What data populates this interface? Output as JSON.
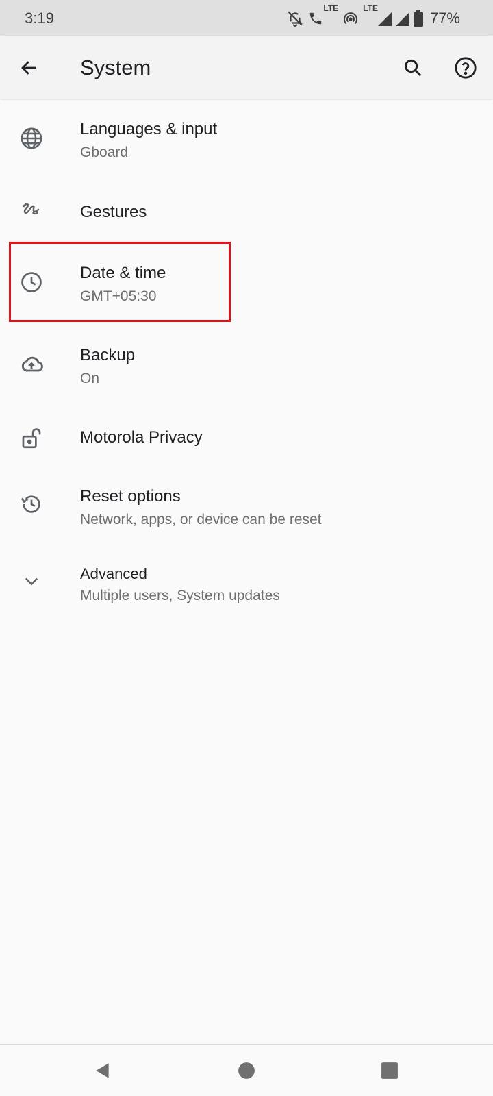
{
  "status_bar": {
    "time": "3:19",
    "lte_label": "LTE",
    "network_label": "LTE",
    "battery": "77%"
  },
  "app_bar": {
    "title": "System"
  },
  "items": [
    {
      "title": "Languages & input",
      "subtitle": "Gboard",
      "icon": "globe-icon"
    },
    {
      "title": "Gestures",
      "icon": "gestures-icon"
    },
    {
      "title": "Date & time",
      "subtitle": "GMT+05:30",
      "icon": "clock-icon"
    },
    {
      "title": "Backup",
      "subtitle": "On",
      "icon": "cloud-upload-icon"
    },
    {
      "title": "Motorola Privacy",
      "icon": "unlocked-padlock-icon"
    },
    {
      "title": "Reset options",
      "subtitle": "Network, apps, or device can be reset",
      "icon": "history-icon"
    },
    {
      "title": "Advanced",
      "subtitle": "Multiple users, System updates",
      "icon": "chevron-down-icon"
    }
  ],
  "highlight_color": "#e0141d"
}
